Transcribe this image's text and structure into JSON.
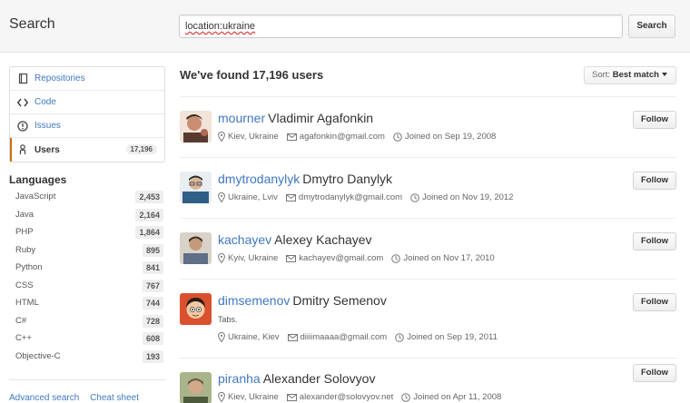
{
  "header": {
    "title": "Search",
    "query": "location:ukraine",
    "search_button": "Search"
  },
  "menu": [
    {
      "label": "Repositories",
      "icon": "repo-icon"
    },
    {
      "label": "Code",
      "icon": "code-icon"
    },
    {
      "label": "Issues",
      "icon": "issue-icon"
    },
    {
      "label": "Users",
      "icon": "person-icon",
      "count": "17,196",
      "selected": true
    }
  ],
  "languages": {
    "heading": "Languages",
    "items": [
      {
        "name": "JavaScript",
        "count": "2,453"
      },
      {
        "name": "Java",
        "count": "2,164"
      },
      {
        "name": "PHP",
        "count": "1,864"
      },
      {
        "name": "Ruby",
        "count": "895"
      },
      {
        "name": "Python",
        "count": "841"
      },
      {
        "name": "CSS",
        "count": "767"
      },
      {
        "name": "HTML",
        "count": "744"
      },
      {
        "name": "C#",
        "count": "728"
      },
      {
        "name": "C++",
        "count": "608"
      },
      {
        "name": "Objective-C",
        "count": "193"
      }
    ]
  },
  "footer_links": {
    "advanced": "Advanced search",
    "cheat": "Cheat sheet"
  },
  "results": {
    "title": "We've found 17,196 users",
    "sort_label": "Sort:",
    "sort_value": "Best match"
  },
  "users": [
    {
      "login": "mourner",
      "name": "Vladimir Agafonkin",
      "bio": "",
      "location": "Kiev, Ukraine",
      "email": "agafonkin@gmail.com",
      "joined": "Joined on Sep 19, 2008",
      "follow": "Follow",
      "avatar_color": "#b06a52"
    },
    {
      "login": "dmytrodanylyk",
      "name": "Dmytro Danylyk",
      "bio": "",
      "location": "Ukraine, Lviv",
      "email": "dmytrodanylyk@gmail.com",
      "joined": "Joined on Nov 19, 2012",
      "follow": "Follow",
      "avatar_color": "#2f5e86"
    },
    {
      "login": "kachayev",
      "name": "Alexey Kachayev",
      "bio": "",
      "location": "Kyiv, Ukraine",
      "email": "kachayev@gmail.com",
      "joined": "Joined on Nov 17, 2010",
      "follow": "Follow",
      "avatar_color": "#7d7264"
    },
    {
      "login": "dimsemenov",
      "name": "Dmitry Semenov",
      "bio": "Tabs.",
      "location": "Ukraine, Kiev",
      "email": "diiiimaaaa@gmail.com",
      "joined": "Joined on Sep 19, 2011",
      "follow": "Follow",
      "avatar_color": "#d9502f"
    },
    {
      "login": "piranha",
      "name": "Alexander Solovyov",
      "bio": "",
      "location": "Kiev, Ukraine",
      "email": "alexander@solovyov.net",
      "joined": "Joined on Apr 11, 2008",
      "follow": "Follow",
      "avatar_color": "#7a8a5c"
    }
  ]
}
